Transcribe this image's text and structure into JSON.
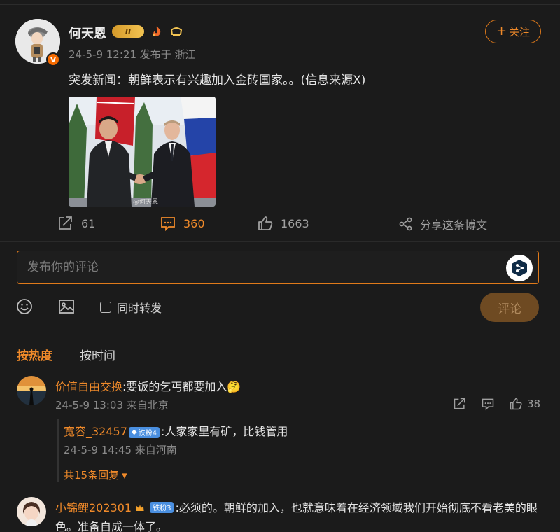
{
  "post": {
    "author": "何天恩",
    "level_badge": "II",
    "meta": "24-5-9 12:21 发布于 浙江",
    "follow_label": "关注",
    "text": "突发新闻：朝鲜表示有兴趣加入金砖国家。。(信息来源X)",
    "image_watermark": "@何天恩"
  },
  "actions": {
    "repost_count": "61",
    "comment_count": "360",
    "like_count": "1663",
    "share_label": "分享这条博文"
  },
  "composer": {
    "placeholder": "发布你的评论",
    "repost_label": "同时转发",
    "submit_label": "评论"
  },
  "sort": {
    "hot": "按热度",
    "time": "按时间"
  },
  "comments": [
    {
      "user": "价值自由交换",
      "text": ":要饭的乞丐都要加入",
      "emoji": "🤔",
      "meta": "24-5-9 13:03 来自北京",
      "like_count": "38",
      "reply": {
        "user": "宽容_32457",
        "fan_badge": "铁粉4",
        "text": ":人家家里有矿，比钱管用",
        "meta": "24-5-9 14:45 来自河南"
      },
      "more_replies": "共15条回复"
    },
    {
      "user": "小锦鲤202301",
      "fan_badge": "铁粉3",
      "text_line1": ":必须的。朝鲜的加入，也就意味着在经济领域我们开始彻底不看老美的眼",
      "text_line2": "色。准备自成一体了。"
    }
  ],
  "colors": {
    "background": "#1b1b1b",
    "accent": "#f08a2a",
    "muted": "#8a8a8a",
    "fan_badge": "#4a8fe0"
  }
}
